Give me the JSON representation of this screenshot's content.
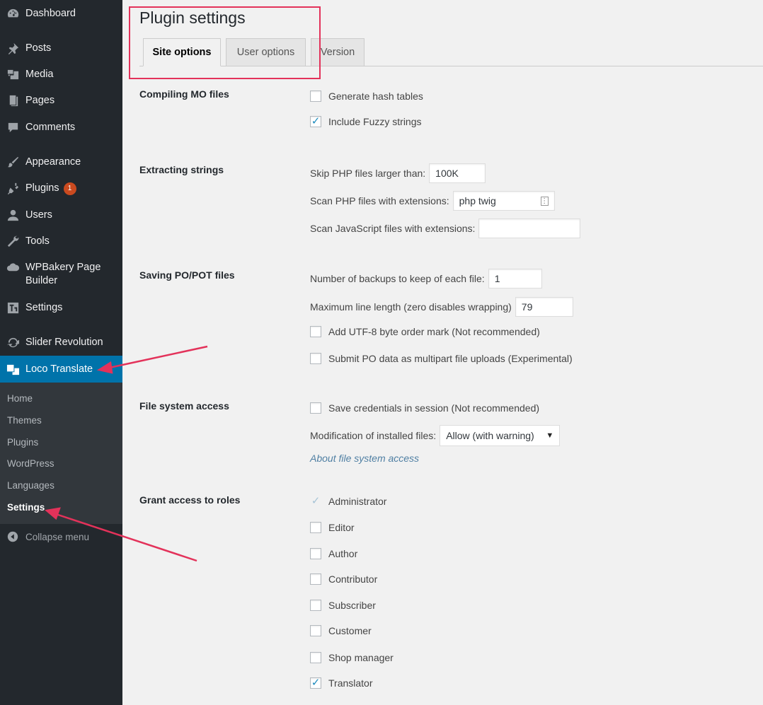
{
  "sidebar": {
    "items": [
      {
        "label": "Dashboard",
        "icon": "dashboard-icon"
      },
      {
        "label": "Posts",
        "icon": "pin-icon"
      },
      {
        "label": "Media",
        "icon": "media-icon"
      },
      {
        "label": "Pages",
        "icon": "pages-icon"
      },
      {
        "label": "Comments",
        "icon": "comment-icon"
      },
      {
        "label": "Appearance",
        "icon": "brush-icon"
      },
      {
        "label": "Plugins",
        "icon": "plugin-icon",
        "badge": "1"
      },
      {
        "label": "Users",
        "icon": "user-icon"
      },
      {
        "label": "Tools",
        "icon": "wrench-icon"
      },
      {
        "label": "WPBakery Page Builder",
        "icon": "cloud-icon"
      },
      {
        "label": "Settings",
        "icon": "settings-icon"
      },
      {
        "label": "Slider Revolution",
        "icon": "refresh-icon"
      },
      {
        "label": "Loco Translate",
        "icon": "translate-icon"
      }
    ],
    "submenu": [
      "Home",
      "Themes",
      "Plugins",
      "WordPress",
      "Languages",
      "Settings"
    ],
    "collapse_label": "Collapse menu"
  },
  "page": {
    "title": "Plugin settings",
    "tabs": [
      "Site options",
      "User options",
      "Version"
    ]
  },
  "sections": {
    "compiling": {
      "label": "Compiling MO files",
      "generate_hash": "Generate hash tables",
      "include_fuzzy": "Include Fuzzy strings"
    },
    "extracting": {
      "label": "Extracting strings",
      "skip_php_label": "Skip PHP files larger than:",
      "skip_php_value": "100K",
      "scan_php_label": "Scan PHP files with extensions:",
      "scan_php_value": "php twig",
      "scan_js_label": "Scan JavaScript files with extensions:",
      "scan_js_value": ""
    },
    "saving": {
      "label": "Saving PO/POT files",
      "backups_label": "Number of backups to keep of each file:",
      "backups_value": "1",
      "line_length_label": "Maximum line length (zero disables wrapping)",
      "line_length_value": "79",
      "utf8_bom": "Add UTF-8 byte order mark (Not recommended)",
      "multipart": "Submit PO data as multipart file uploads (Experimental)"
    },
    "filesystem": {
      "label": "File system access",
      "save_credentials": "Save credentials in session (Not recommended)",
      "modification_label": "Modification of installed files:",
      "modification_value": "Allow (with warning)",
      "about_link": "About file system access"
    },
    "roles": {
      "label": "Grant access to roles",
      "items": [
        "Administrator",
        "Editor",
        "Author",
        "Contributor",
        "Subscriber",
        "Customer",
        "Shop manager",
        "Translator"
      ]
    }
  },
  "colors": {
    "sidebar_bg": "#23282d",
    "active_menu": "#0073aa",
    "annotation": "#e3325a",
    "badge": "#ca4a1f"
  }
}
